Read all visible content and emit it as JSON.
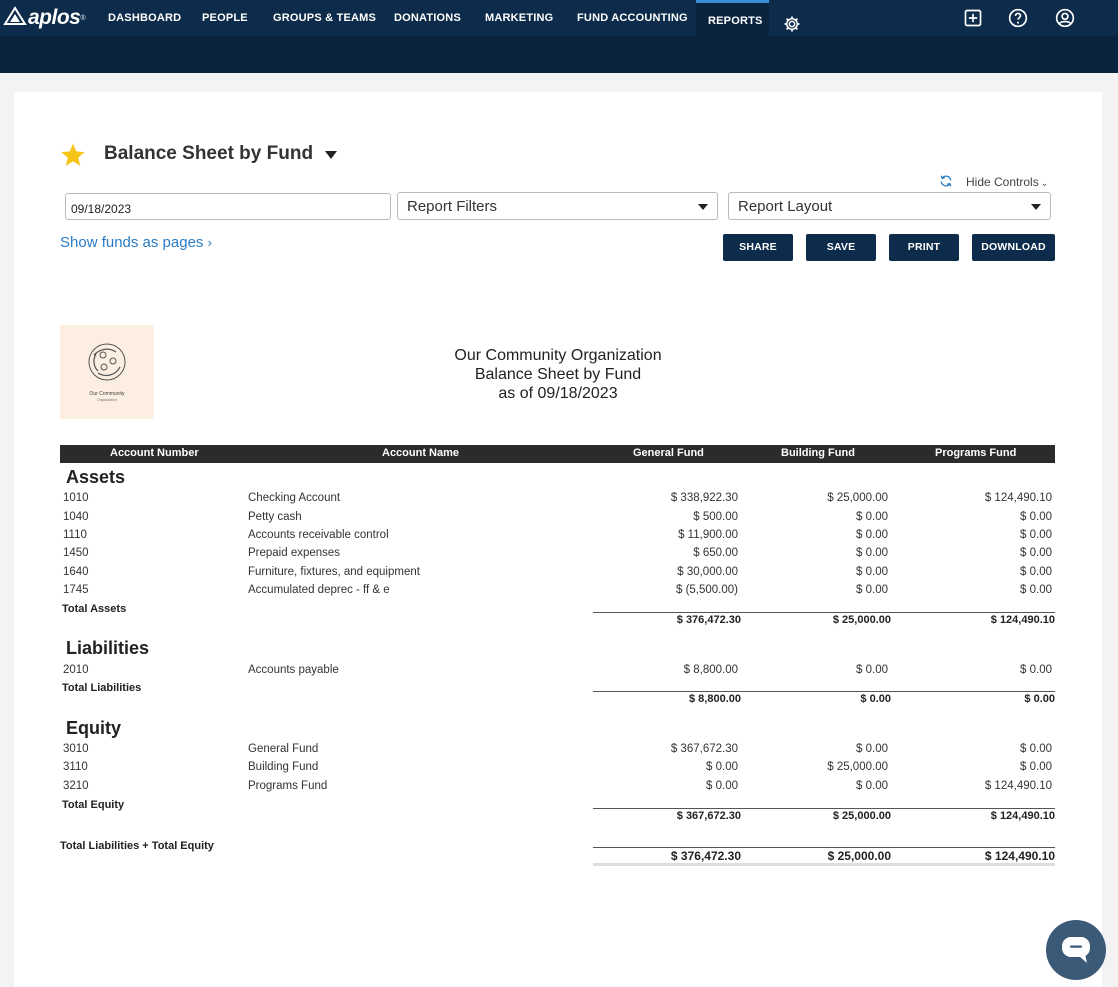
{
  "brand": {
    "name": "aplos",
    "reg": "®"
  },
  "nav": {
    "items": [
      "DASHBOARD",
      "PEOPLE",
      "GROUPS & TEAMS",
      "DONATIONS",
      "MARKETING",
      "FUND ACCOUNTING",
      "REPORTS"
    ],
    "active": "REPORTS",
    "icons": [
      "gear-icon",
      "plus-square-icon",
      "help-circle-icon",
      "user-circle-icon"
    ]
  },
  "report": {
    "title": "Balance Sheet by Fund",
    "hide_controls": "Hide Controls",
    "date": "09/18/2023",
    "filters_label": "Report Filters",
    "layout_label": "Report Layout",
    "show_funds": "Show funds as pages",
    "buttons": {
      "share": "SHARE",
      "save": "SAVE",
      "print": "PRINT",
      "download": "DOWNLOAD"
    },
    "org_logo_line1": "Our Community",
    "org_logo_line2": "Organization",
    "heading": {
      "org": "Our Community Organization",
      "name": "Balance Sheet by Fund",
      "asof": "as of 09/18/2023"
    }
  },
  "table": {
    "headers": {
      "account_number": "Account Number",
      "account_name": "Account Name",
      "general": "General Fund",
      "building": "Building Fund",
      "programs": "Programs Fund"
    },
    "assets": {
      "title": "Assets",
      "rows": [
        {
          "num": "1010",
          "name": "Checking Account",
          "general": "$ 338,922.30",
          "building": "$ 25,000.00",
          "programs": "$ 124,490.10"
        },
        {
          "num": "1040",
          "name": "Petty cash",
          "general": "$ 500.00",
          "building": "$ 0.00",
          "programs": "$ 0.00"
        },
        {
          "num": "1110",
          "name": "Accounts receivable control",
          "general": "$ 11,900.00",
          "building": "$ 0.00",
          "programs": "$ 0.00"
        },
        {
          "num": "1450",
          "name": "Prepaid expenses",
          "general": "$ 650.00",
          "building": "$ 0.00",
          "programs": "$ 0.00"
        },
        {
          "num": "1640",
          "name": "Furniture, fixtures, and equipment",
          "general": "$ 30,000.00",
          "building": "$ 0.00",
          "programs": "$ 0.00"
        },
        {
          "num": "1745",
          "name": "Accumulated deprec - ff & e",
          "general": "$ (5,500.00)",
          "building": "$ 0.00",
          "programs": "$ 0.00"
        }
      ],
      "total_label": "Total Assets",
      "total": {
        "general": "$ 376,472.30",
        "building": "$ 25,000.00",
        "programs": "$ 124,490.10"
      }
    },
    "liabilities": {
      "title": "Liabilities",
      "rows": [
        {
          "num": "2010",
          "name": "Accounts payable",
          "general": "$ 8,800.00",
          "building": "$ 0.00",
          "programs": "$ 0.00"
        }
      ],
      "total_label": "Total Liabilities",
      "total": {
        "general": "$ 8,800.00",
        "building": "$ 0.00",
        "programs": "$ 0.00"
      }
    },
    "equity": {
      "title": "Equity",
      "rows": [
        {
          "num": "3010",
          "name": "General Fund",
          "general": "$ 367,672.30",
          "building": "$ 0.00",
          "programs": "$ 0.00"
        },
        {
          "num": "3110",
          "name": "Building Fund",
          "general": "$ 0.00",
          "building": "$ 25,000.00",
          "programs": "$ 0.00"
        },
        {
          "num": "3210",
          "name": "Programs Fund",
          "general": "$ 0.00",
          "building": "$ 0.00",
          "programs": "$ 124,490.10"
        }
      ],
      "total_label": "Total Equity",
      "total": {
        "general": "$ 367,672.30",
        "building": "$ 25,000.00",
        "programs": "$ 124,490.10"
      }
    },
    "grand": {
      "label": "Total Liabilities + Total Equity",
      "general": "$ 376,472.30",
      "building": "$ 25,000.00",
      "programs": "$ 124,490.10"
    }
  },
  "colors": {
    "nav": "#0d2b4a",
    "accent": "#3a8fd9",
    "link": "#2a7bc4",
    "star": "#f5c518"
  }
}
